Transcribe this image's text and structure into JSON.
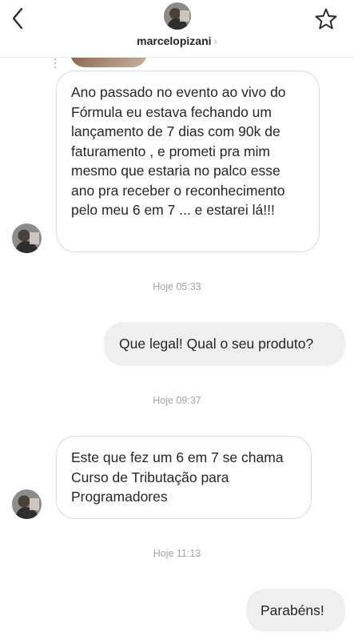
{
  "header": {
    "username": "marcelopizani",
    "chevron": "›",
    "back_icon": "chevron-left-icon",
    "star_icon": "star-outline-icon"
  },
  "messages": [
    {
      "direction": "incoming",
      "text": "Ano passado no evento ao vivo do Fórmula eu estava fechando um lançamento de 7 dias com 90k de faturamento , e prometi pra mim mesmo que estaria no palco esse ano pra receber o reconhecimento pelo meu 6 em 7 ... e estarei lá!!!"
    },
    {
      "type": "timestamp",
      "text": "Hoje 05:33"
    },
    {
      "direction": "outgoing",
      "text": "Que legal! Qual o seu produto?"
    },
    {
      "type": "timestamp",
      "text": "Hoje 09:37"
    },
    {
      "direction": "incoming",
      "text": "Este que fez um 6 em 7 se chama Curso de Tributação para Programadores"
    },
    {
      "type": "timestamp",
      "text": "Hoje 11:13"
    },
    {
      "direction": "outgoing",
      "text": "Parabéns!"
    }
  ],
  "colors": {
    "incoming_bubble_bg": "#ffffff",
    "incoming_bubble_border": "#dbdbdb",
    "outgoing_bubble_bg": "#efefef",
    "timestamp_text": "#a5a5a5",
    "primary_text": "#262626"
  }
}
